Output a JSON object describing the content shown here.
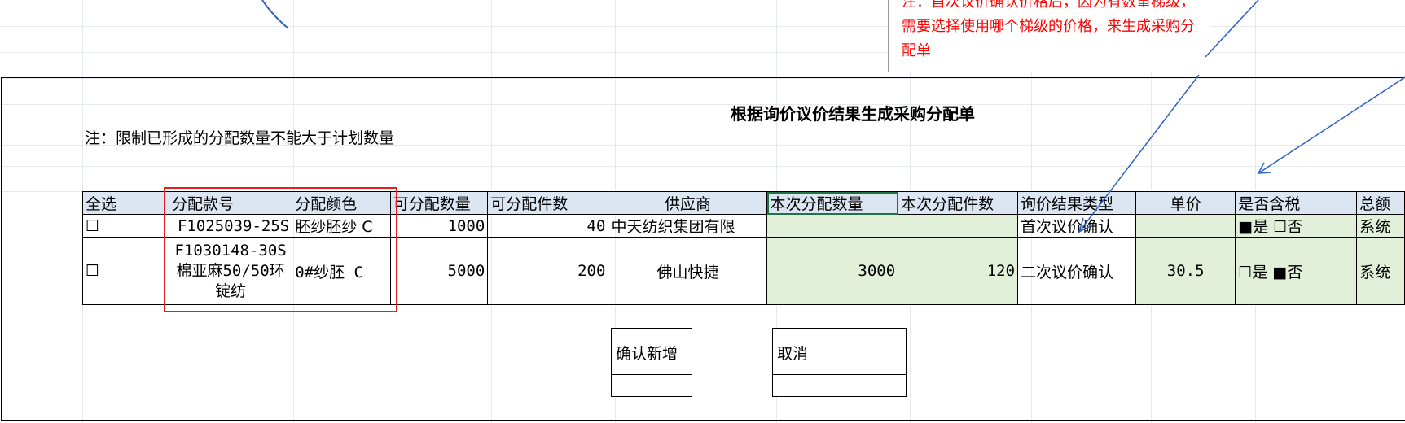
{
  "annotation_note": "注：首次议价确认价格后，因为有数量梯级，需要选择使用哪个梯级的价格，来生成采购分配单",
  "title": "根据询价议价结果生成采购分配单",
  "sub_note": "注：限制已形成的分配数量不能大于计划数量",
  "table": {
    "headers": [
      "全选",
      "分配款号",
      "分配颜色",
      "可分配数量",
      "可分配件数",
      "供应商",
      "本次分配数量",
      "本次分配件数",
      "询价结果类型",
      "单价",
      "是否含税",
      "总额"
    ],
    "rows": [
      {
        "checkbox": "☐",
        "style_no": "F1025039-25S",
        "color": "胚纱胚纱 C",
        "available_qty": "1000",
        "available_pcs": "40",
        "supplier": "中天纺织集团有限",
        "alloc_qty": "",
        "alloc_pcs": "",
        "result_type": "首次议价确认",
        "unit_price": "",
        "tax": "■是 ☐否",
        "total": "系统"
      },
      {
        "checkbox": "☐",
        "style_no": "F1030148-30S棉亚麻50/50环锭纺",
        "color": "0#纱胚 C",
        "available_qty": "5000",
        "available_pcs": "200",
        "supplier": "佛山快捷",
        "alloc_qty": "3000",
        "alloc_pcs": "120",
        "result_type": "二次议价确认",
        "unit_price": "30.5",
        "tax": "☐是 ■否",
        "total": "系统"
      }
    ]
  },
  "buttons": {
    "confirm": "确认新增",
    "cancel": "取消"
  },
  "colors": {
    "header_bg": "#dce6f2",
    "input_bg": "#e2efd9",
    "note_red": "#ff0000",
    "highlight_red": "#e02020",
    "arrow_blue": "#2f5fc4"
  }
}
